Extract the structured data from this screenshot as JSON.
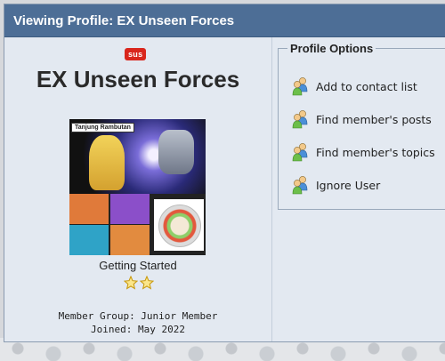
{
  "header": {
    "title": "Viewing Profile: EX Unseen Forces"
  },
  "profile": {
    "badge": "sus",
    "username": "EX Unseen Forces",
    "avatar_caption": "Tanjung Rambutan",
    "rank_title": "Getting Started",
    "rank_stars": 2,
    "member_group": "Member Group: Junior Member",
    "joined": "Joined: May 2022"
  },
  "options": {
    "legend": "Profile Options",
    "items": [
      {
        "label": "Add to contact list",
        "icon": "people-icon"
      },
      {
        "label": "Find member's posts",
        "icon": "people-icon"
      },
      {
        "label": "Find member's topics",
        "icon": "people-icon"
      },
      {
        "label": "Ignore User",
        "icon": "people-icon"
      }
    ]
  },
  "colors": {
    "titlebar": "#4d6e96",
    "panel_bg": "#e3e9f1",
    "badge": "#d9261c",
    "star": "#f2c21a"
  }
}
